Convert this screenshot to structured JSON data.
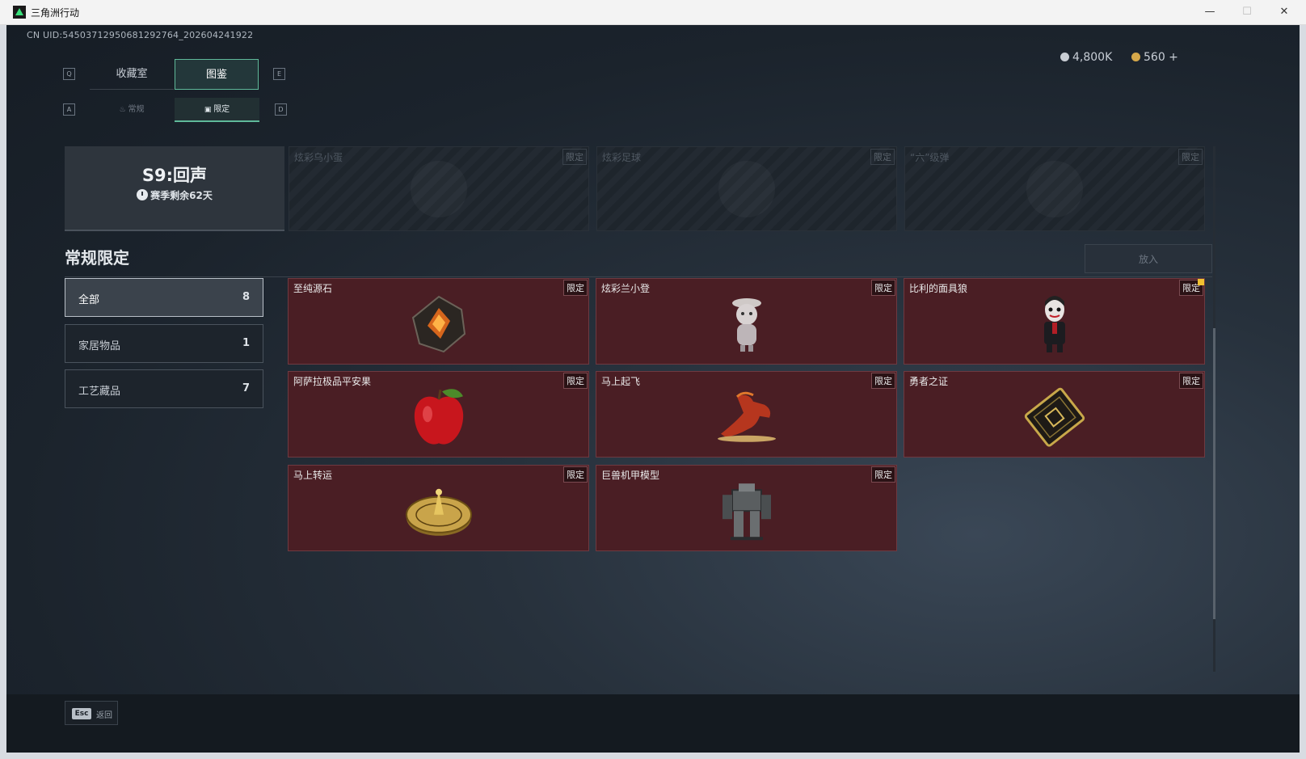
{
  "window": {
    "title": "三角洲行动",
    "min": "—",
    "max": "☐",
    "close": "✕"
  },
  "uid": "CN UID:5450371295068129276​4_202604241922",
  "currency": [
    {
      "icon": "silver-coin-icon",
      "value": "4,800K"
    },
    {
      "icon": "gold-coin-icon",
      "value": "560 +"
    }
  ],
  "hints": {
    "q": "Q",
    "e": "E",
    "a": "A",
    "d": "D"
  },
  "tabs": [
    {
      "label": "收藏室",
      "active": false
    },
    {
      "label": "图鉴",
      "active": true
    }
  ],
  "subtabs": [
    {
      "label": "常规",
      "active": false
    },
    {
      "label": "限定",
      "active": true
    }
  ],
  "season": {
    "title": "S9:回声",
    "remaining": "赛季剩余62天"
  },
  "top_cards": [
    {
      "name": "炫彩乌小蛋",
      "tag": "限定"
    },
    {
      "name": "炫彩足球",
      "tag": "限定"
    },
    {
      "name": "“六”级弹",
      "tag": "限定"
    }
  ],
  "section": {
    "title": "常规限定",
    "put_button": "放入"
  },
  "categories": [
    {
      "label": "全部",
      "count": "8",
      "active": true
    },
    {
      "label": "家居物品",
      "count": "1",
      "active": false
    },
    {
      "label": "工艺藏品",
      "count": "7",
      "active": false
    }
  ],
  "items": [
    {
      "name": "至纯源石",
      "tag": "限定",
      "icon": "crystal-stone-icon"
    },
    {
      "name": "炫彩兰小登",
      "tag": "限定",
      "icon": "doll-figure-icon"
    },
    {
      "name": "比利的面具狼",
      "tag": "限定",
      "icon": "puppet-figure-icon"
    },
    {
      "name": "阿萨拉极品平安果",
      "tag": "限定",
      "icon": "apple-icon"
    },
    {
      "name": "马上起飞",
      "tag": "限定",
      "icon": "flying-horse-icon"
    },
    {
      "name": "勇者之证",
      "tag": "限定",
      "icon": "badge-card-icon"
    },
    {
      "name": "马上转运",
      "tag": "限定",
      "icon": "golden-wheel-icon"
    },
    {
      "name": "巨兽机甲模型",
      "tag": "限定",
      "icon": "mech-model-icon"
    }
  ],
  "footer": {
    "key": "Esc",
    "label": "返回"
  }
}
